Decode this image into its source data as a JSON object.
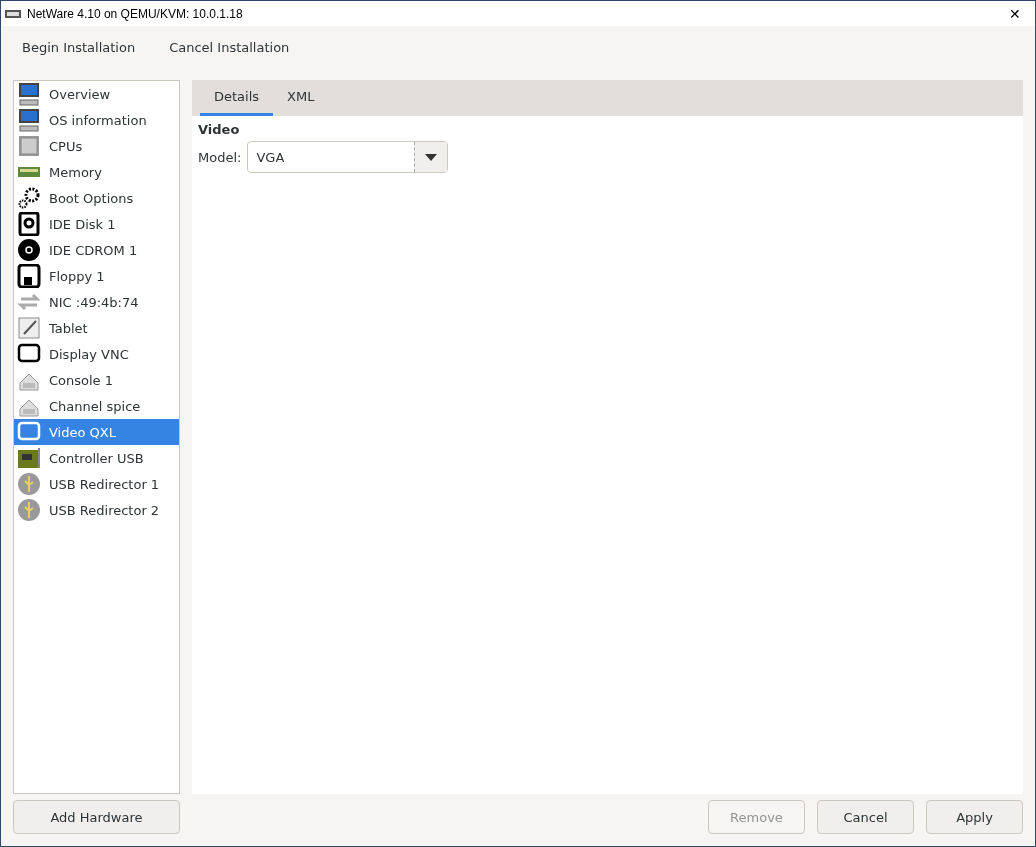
{
  "window": {
    "title": "NetWare 4.10 on QEMU/KVM: 10.0.1.18",
    "close": "✕"
  },
  "toolbar": [
    "Begin Installation",
    "Cancel Installation"
  ],
  "sidebar": {
    "items": [
      {
        "label": "Overview",
        "kind": "computer",
        "selected": false
      },
      {
        "label": "OS information",
        "kind": "computer",
        "selected": false
      },
      {
        "label": "CPUs",
        "kind": "chip",
        "selected": false
      },
      {
        "label": "Memory",
        "kind": "memory",
        "selected": false
      },
      {
        "label": "Boot Options",
        "kind": "gears",
        "selected": false
      },
      {
        "label": "IDE Disk 1",
        "kind": "disk",
        "selected": false
      },
      {
        "label": "IDE CDROM 1",
        "kind": "cdrom",
        "selected": false
      },
      {
        "label": "Floppy 1",
        "kind": "floppy",
        "selected": false
      },
      {
        "label": "NIC :49:4b:74",
        "kind": "network",
        "selected": false
      },
      {
        "label": "Tablet",
        "kind": "tablet",
        "selected": false
      },
      {
        "label": "Display VNC",
        "kind": "monitor",
        "selected": false
      },
      {
        "label": "Console 1",
        "kind": "serial",
        "selected": false
      },
      {
        "label": "Channel spice",
        "kind": "serial",
        "selected": false
      },
      {
        "label": "Video QXL",
        "kind": "monitor",
        "selected": true
      },
      {
        "label": "Controller USB",
        "kind": "card",
        "selected": false
      },
      {
        "label": "USB Redirector 1",
        "kind": "usb",
        "selected": false
      },
      {
        "label": "USB Redirector 2",
        "kind": "usb",
        "selected": false
      }
    ]
  },
  "tabs": [
    {
      "label": "Details",
      "selected": true
    },
    {
      "label": "XML",
      "selected": false
    }
  ],
  "details": {
    "heading": "Video",
    "model_label": "Model:",
    "model_value": "VGA"
  },
  "add_button": "Add Hardware",
  "buttons": [
    {
      "label": "Remove",
      "disabled": true
    },
    {
      "label": "Cancel",
      "disabled": false
    },
    {
      "label": "Apply",
      "disabled": false
    }
  ]
}
